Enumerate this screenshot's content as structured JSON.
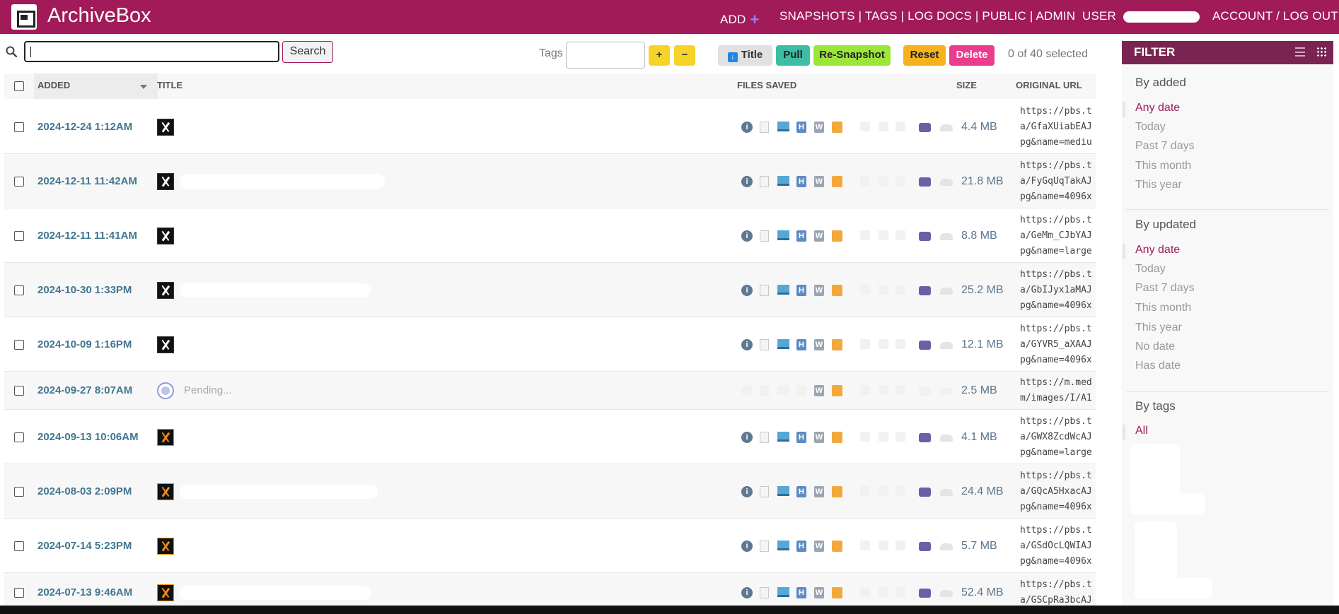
{
  "header": {
    "brand": "ArchiveBox",
    "add_label": "ADD",
    "add_plus": "+",
    "nav_main": "SNAPSHOTS | TAGS | LOG",
    "nav_docs": "DOCS | PUBLIC | ADMIN",
    "user_label": "USER",
    "nav_account": "ACCOUNT / LOG OUT"
  },
  "toolbar": {
    "search_value": "",
    "search_button": "Search",
    "tags_label": "Tags",
    "tag_add": "+",
    "tag_remove": "−",
    "title_button": "Title",
    "title_icon": "↓",
    "pull_button": "Pull",
    "resnapshot_button": "Re-Snapshot",
    "reset_button": "Reset",
    "delete_button": "Delete",
    "selected_count": "0 of 40 selected"
  },
  "table": {
    "columns": [
      "ADDED",
      "TITLE",
      "FILES SAVED",
      "SIZE",
      "ORIGINAL URL"
    ],
    "rows": [
      {
        "added": "2024-12-24 1:12AM",
        "favicon": "x-logo-icon",
        "title": "",
        "size": "4.4 MB",
        "url": "https://pbs.t\na/GfaXUiabEAJ\npg&name=mediu"
      },
      {
        "added": "2024-12-11 11:42AM",
        "favicon": "x-logo-icon",
        "title": "",
        "size": "21.8 MB",
        "url": "https://pbs.t\na/FyGqUqTakAJ\npg&name=4096x"
      },
      {
        "added": "2024-12-11 11:41AM",
        "favicon": "x-logo-icon",
        "title": "",
        "size": "8.8 MB",
        "url": "https://pbs.t\na/GeMm_CJbYAJ\npg&name=large"
      },
      {
        "added": "2024-10-30 1:33PM",
        "favicon": "x-logo-icon",
        "title": "",
        "size": "25.2 MB",
        "url": "https://pbs.t\na/GbIJyx1aMAJ\npg&name=4096x"
      },
      {
        "added": "2024-10-09 1:16PM",
        "favicon": "x-logo-icon",
        "title": "",
        "size": "12.1 MB",
        "url": "https://pbs.t\na/GYVR5_aXAAJ\npg&name=4096x"
      },
      {
        "added": "2024-09-27 8:07AM",
        "favicon": "globe-icon",
        "title": "Pending...",
        "size": "2.5 MB",
        "url": "https://m.med\nm/images/I/A1"
      },
      {
        "added": "2024-09-13 10:06AM",
        "favicon": "x-logo-orange-icon",
        "title": "",
        "size": "4.1 MB",
        "url": "https://pbs.t\na/GWX8ZcdWcAJ\npg&name=large"
      },
      {
        "added": "2024-08-03 2:09PM",
        "favicon": "x-logo-orange-icon",
        "title": "",
        "size": "24.4 MB",
        "url": "https://pbs.t\na/GQcA5HxacAJ\npg&name=4096x"
      },
      {
        "added": "2024-07-14 5:23PM",
        "favicon": "x-logo-orange-icon",
        "title": "",
        "size": "5.7 MB",
        "url": "https://pbs.t\na/GSdOcLQWIAJ\npg&name=4096x"
      },
      {
        "added": "2024-07-13 9:46AM",
        "favicon": "x-logo-orange-icon",
        "title": "",
        "size": "52.4 MB",
        "url": "https://pbs.t\na/GSCpRa3bcAJ"
      }
    ]
  },
  "filter": {
    "title": "FILTER",
    "by_added": {
      "title": "By added",
      "options": [
        "Any date",
        "Today",
        "Past 7 days",
        "This month",
        "This year"
      ],
      "selected": "Any date"
    },
    "by_updated": {
      "title": "By updated",
      "options": [
        "Any date",
        "Today",
        "Past 7 days",
        "This month",
        "This year",
        "No date",
        "Has date"
      ],
      "selected": "Any date"
    },
    "by_tags": {
      "title": "By tags",
      "options": [
        "All"
      ],
      "selected": "All"
    }
  },
  "colors": {
    "header_bg": "#a11b58",
    "filter_header_bg": "#7a2551",
    "link_blue": "#417690"
  }
}
